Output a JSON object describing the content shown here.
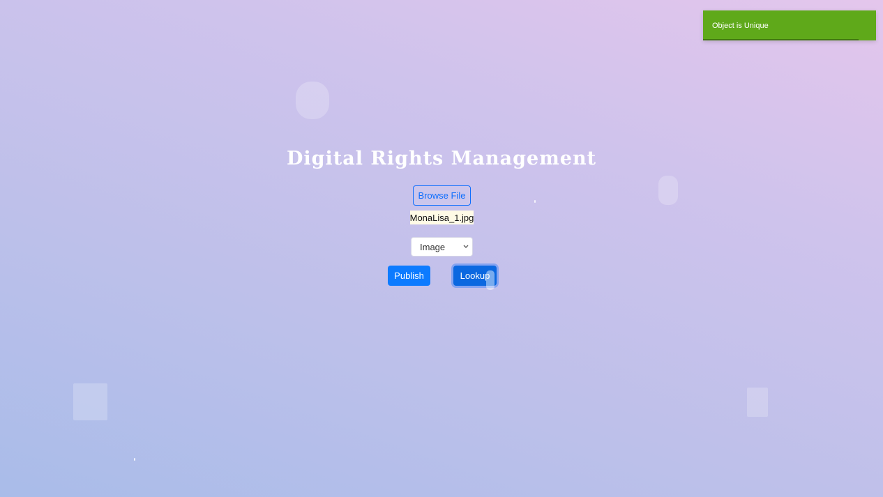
{
  "page": {
    "title": "Digital Rights Management"
  },
  "upload": {
    "browse_label": "Browse File",
    "selected_file": "MonaLisa_1.jpg"
  },
  "type_select": {
    "selected": "Image",
    "icon": "chevron-down-icon"
  },
  "actions": {
    "publish_label": "Publish",
    "lookup_label": "Lookup"
  },
  "toast": {
    "message": "Object is Unique",
    "remaining_fraction": 0.9,
    "color": "#5fa91a"
  },
  "colors": {
    "accent": "#0d6efd"
  }
}
